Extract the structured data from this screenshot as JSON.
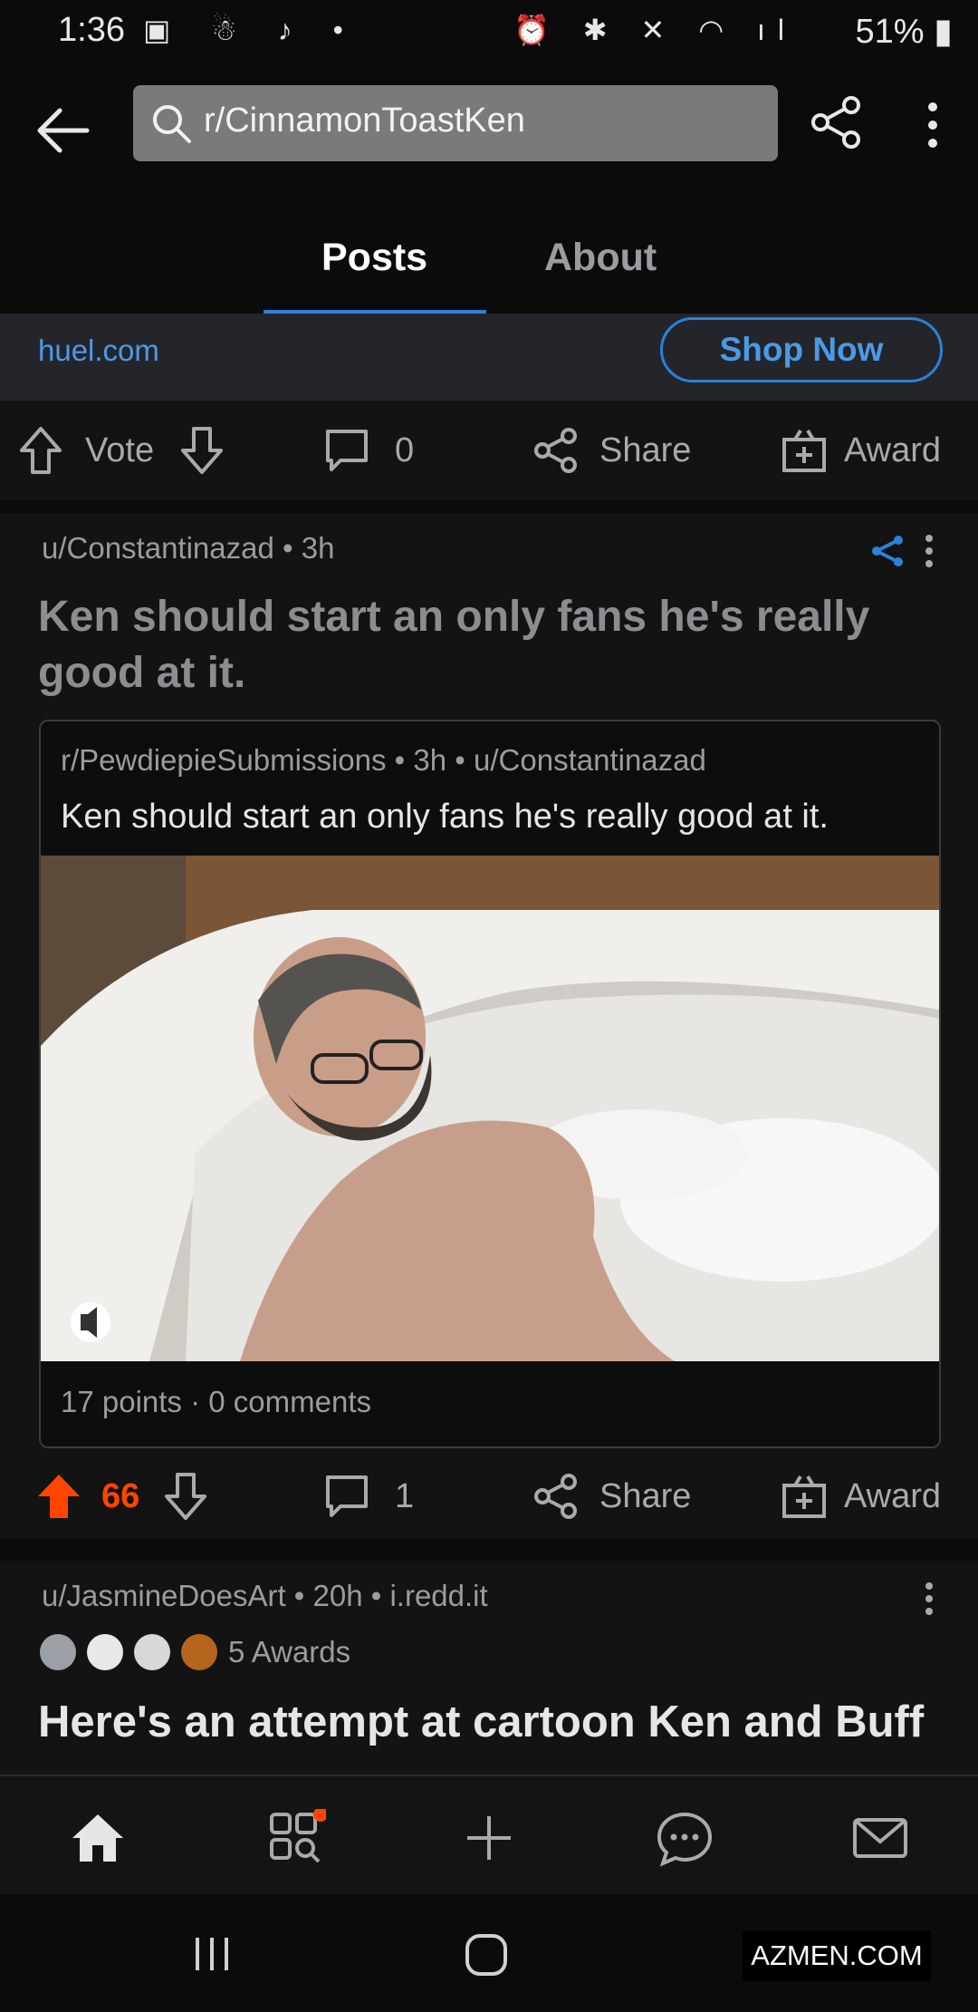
{
  "status_bar": {
    "time": "1:36",
    "battery": "51%"
  },
  "header": {
    "search_text": "r/CinnamonToastKen"
  },
  "tabs": [
    {
      "label": "Posts"
    },
    {
      "label": "About"
    }
  ],
  "ad": {
    "domain": "huel.com",
    "cta": "Shop Now",
    "actions": {
      "vote": "Vote",
      "comments": "0",
      "share": "Share",
      "award": "Award"
    }
  },
  "post": {
    "author": "u/Constantinazad",
    "age": "3h",
    "title": "Ken should start an only fans he's really good at it.",
    "crosspost": {
      "subreddit": "r/PewdiepieSubmissions",
      "age": "3h",
      "author": "u/Constantinazad",
      "title": "Ken should start an only fans he's really good at it.",
      "stats": "17 points · 0 comments"
    },
    "actions": {
      "score": "66",
      "comments": "1",
      "share": "Share",
      "award": "Award"
    }
  },
  "post2": {
    "author": "u/JasmineDoesArt",
    "age": "20h",
    "domain": "i.redd.it",
    "awards": "5 Awards",
    "title": "Here's an attempt at cartoon Ken and Buff"
  },
  "watermark": "AZMEN.COM",
  "colors": {
    "accent_blue": "#2a82d9",
    "upvote_orange": "#ff4500",
    "background": "#0b0b0c"
  }
}
